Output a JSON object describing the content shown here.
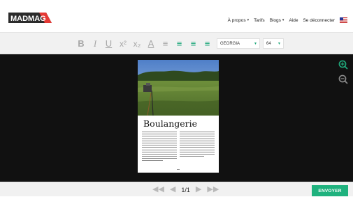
{
  "header": {
    "logo_text": "MADMAG",
    "nav": [
      {
        "label": "À propos",
        "has_dropdown": true
      },
      {
        "label": "Tarifs",
        "has_dropdown": false
      },
      {
        "label": "Blogs",
        "has_dropdown": true
      },
      {
        "label": "Aide",
        "has_dropdown": false
      },
      {
        "label": "Se déconnecter",
        "has_dropdown": false
      }
    ],
    "flag_icon": "us-flag-icon"
  },
  "toolbar": {
    "buttons": [
      {
        "name": "bold",
        "glyph": "B"
      },
      {
        "name": "italic",
        "glyph": "I"
      },
      {
        "name": "underline",
        "glyph": "U"
      },
      {
        "name": "superscript",
        "glyph": "x²"
      },
      {
        "name": "subscript",
        "glyph": "x₂"
      },
      {
        "name": "text-color",
        "glyph": "A"
      },
      {
        "name": "align-left",
        "glyph": "≡"
      },
      {
        "name": "align-center",
        "glyph": "≡"
      },
      {
        "name": "align-right",
        "glyph": "≡"
      },
      {
        "name": "justify",
        "glyph": "≡"
      }
    ],
    "font_family": "GEORGIA",
    "font_size": "64",
    "accent_color": "#1fa77a"
  },
  "page": {
    "title": "Boulangerie",
    "number": "1/1"
  },
  "footer": {
    "pager_label": "1/1",
    "send_label": "ENVOYER"
  },
  "colors": {
    "accent": "#1fb27e",
    "canvas": "#111111",
    "logo_red": "#e53935"
  }
}
